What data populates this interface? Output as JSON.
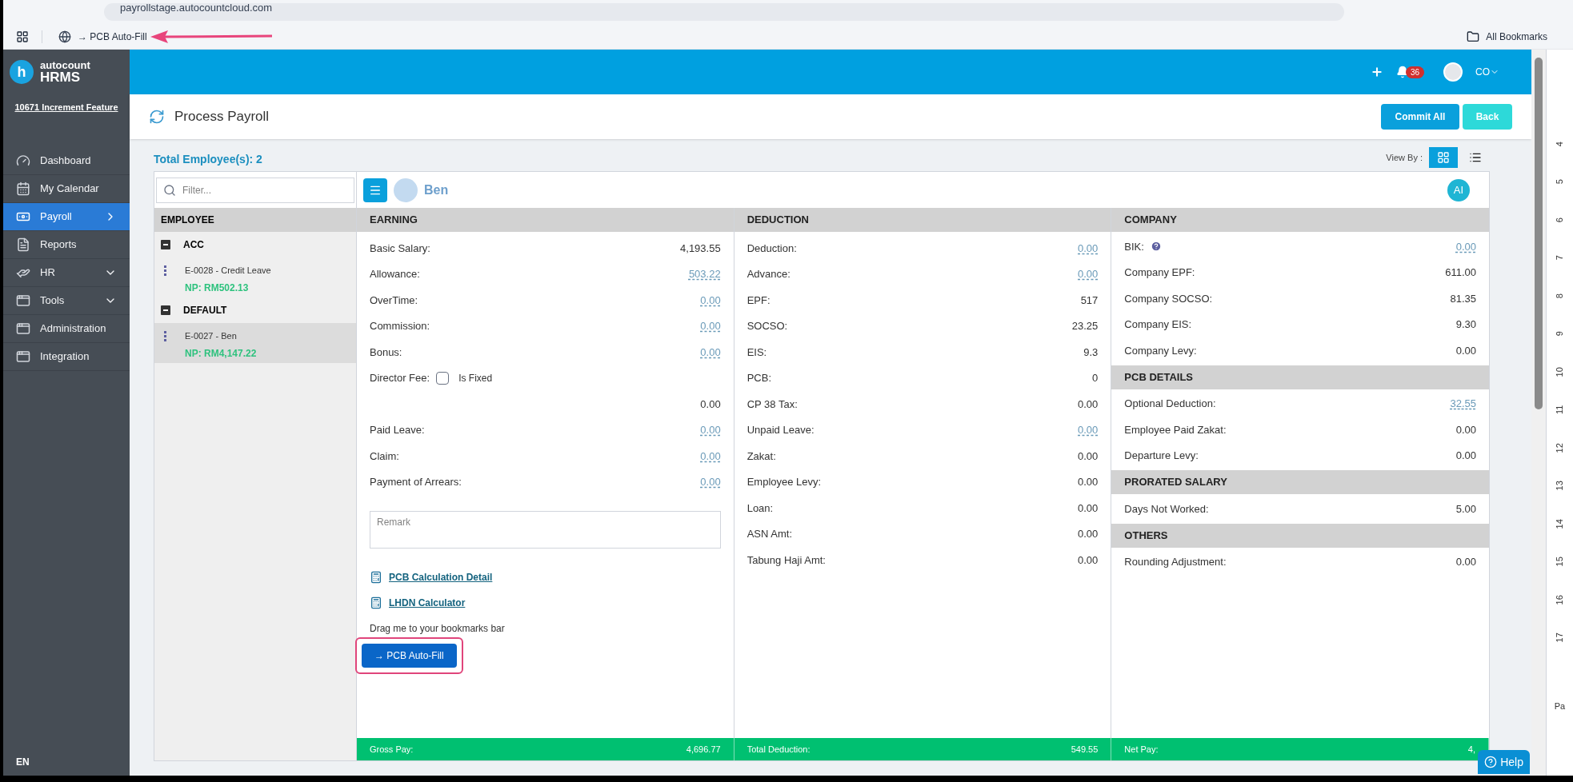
{
  "browser": {
    "url": "payrollstage.autocountcloud.com",
    "bookmarks": [
      {
        "label": "→ PCB Auto-Fill"
      }
    ],
    "all_bookmarks": "All Bookmarks"
  },
  "header": {
    "notifications": "36",
    "user": "CO"
  },
  "sidebar": {
    "logo_letter": "h",
    "logo_top": "autocount",
    "logo_bottom": "HRMS",
    "company": "10671 Increment Feature",
    "language": "EN",
    "items": [
      {
        "label": "Dashboard",
        "kind": "gauge",
        "selected": false,
        "submenu": false
      },
      {
        "label": "My Calendar",
        "kind": "calendar",
        "selected": false,
        "submenu": false
      },
      {
        "label": "Payroll",
        "kind": "money",
        "selected": true,
        "submenu": true
      },
      {
        "label": "Reports",
        "kind": "report",
        "selected": false,
        "submenu": false
      },
      {
        "label": "HR",
        "kind": "hr",
        "selected": false,
        "submenu": true
      },
      {
        "label": "Tools",
        "kind": "panel",
        "selected": false,
        "submenu": true
      },
      {
        "label": "Administration",
        "kind": "panel",
        "selected": false,
        "submenu": false
      },
      {
        "label": "Integration",
        "kind": "panel",
        "selected": false,
        "submenu": false
      }
    ]
  },
  "page": {
    "title": "Process Payroll",
    "buttons": [
      {
        "label": "Commit All",
        "kind": "primary"
      },
      {
        "label": "Back",
        "kind": "secondary"
      }
    ],
    "total": "Total Employee(s): 2",
    "view_by": "View By :",
    "views": [
      {
        "kind": "grid",
        "selected": true
      },
      {
        "kind": "list",
        "selected": false
      }
    ]
  },
  "employees": {
    "filter_placeholder": "Filter...",
    "header": "EMPLOYEE",
    "groups": [
      {
        "name": "ACC",
        "expanded": true,
        "items": [
          {
            "label": "E-0028 - Credit Leave",
            "np": "NP: RM502.13",
            "selected": false
          }
        ]
      },
      {
        "name": "DEFAULT",
        "expanded": true,
        "items": [
          {
            "label": "E-0027 - Ben",
            "np": "NP: RM4,147.22",
            "selected": true
          }
        ]
      }
    ]
  },
  "employee": {
    "name": "Ben",
    "ai_badge": "AI"
  },
  "earning": {
    "header": "EARNING",
    "rows": [
      {
        "kind": "plain",
        "label": "Basic Salary:",
        "value": "4,193.55"
      },
      {
        "kind": "link",
        "label": "Allowance:",
        "value": "503.22"
      },
      {
        "kind": "link",
        "label": "OverTime:",
        "value": "0.00"
      },
      {
        "kind": "link",
        "label": "Commission:",
        "value": "0.00"
      },
      {
        "kind": "link",
        "label": "Bonus:",
        "value": "0.00"
      },
      {
        "kind": "checkbox",
        "label": "Director Fee:",
        "checked": false,
        "check_label": "Is Fixed"
      },
      {
        "kind": "plain",
        "value": "0.00"
      },
      {
        "kind": "link",
        "label": "Paid Leave:",
        "value": "0.00"
      },
      {
        "kind": "link",
        "label": "Claim:",
        "value": "0.00"
      },
      {
        "kind": "link",
        "label": "Payment of Arrears:",
        "value": "0.00"
      }
    ],
    "remark_placeholder": "Remark",
    "links": [
      "PCB Calculation Detail",
      "LHDN Calculator"
    ],
    "drag_hint": "Drag me to your bookmarks bar",
    "bookmarklet": "→ PCB Auto-Fill"
  },
  "deduction": {
    "header": "DEDUCTION",
    "rows": [
      {
        "kind": "link",
        "label": "Deduction:",
        "value": "0.00"
      },
      {
        "kind": "link",
        "label": "Advance:",
        "value": "0.00"
      },
      {
        "kind": "plain",
        "label": "EPF:",
        "value": "517"
      },
      {
        "kind": "plain",
        "label": "SOCSO:",
        "value": "23.25"
      },
      {
        "kind": "plain",
        "label": "EIS:",
        "value": "9.3"
      },
      {
        "kind": "plain",
        "label": "PCB:",
        "value": "0"
      },
      {
        "kind": "plain",
        "label": "CP 38 Tax:",
        "value": "0.00"
      },
      {
        "kind": "link",
        "label": "Unpaid Leave:",
        "value": "0.00"
      },
      {
        "kind": "plain",
        "label": "Zakat:",
        "value": "0.00"
      },
      {
        "kind": "plain",
        "label": "Employee Levy:",
        "value": "0.00"
      },
      {
        "kind": "plain",
        "label": "Loan:",
        "value": "0.00"
      },
      {
        "kind": "plain",
        "label": "ASN Amt:",
        "value": "0.00"
      },
      {
        "kind": "plain",
        "label": "Tabung Haji Amt:",
        "value": "0.00"
      }
    ]
  },
  "company": {
    "sections": [
      {
        "header": "COMPANY",
        "rows": [
          {
            "kind": "help",
            "label": "BIK:",
            "value": "0.00"
          },
          {
            "kind": "plain",
            "label": "Company EPF:",
            "value": "611.00"
          },
          {
            "kind": "plain",
            "label": "Company SOCSO:",
            "value": "81.35"
          },
          {
            "kind": "plain",
            "label": "Company EIS:",
            "value": "9.30"
          },
          {
            "kind": "plain",
            "label": "Company Levy:",
            "value": "0.00"
          }
        ]
      },
      {
        "header": "PCB DETAILS",
        "rows": [
          {
            "kind": "link",
            "label": "Optional Deduction:",
            "value": "32.55"
          },
          {
            "kind": "plain",
            "label": "Employee Paid Zakat:",
            "value": "0.00"
          },
          {
            "kind": "plain",
            "label": "Departure Levy:",
            "value": "0.00"
          }
        ]
      },
      {
        "header": "PRORATED SALARY",
        "rows": [
          {
            "kind": "plain",
            "label": "Days Not Worked:",
            "value": "5.00"
          }
        ]
      },
      {
        "header": "OTHERS",
        "rows": [
          {
            "kind": "plain",
            "label": "Rounding Adjustment:",
            "value": "0.00"
          }
        ]
      }
    ]
  },
  "totals": [
    {
      "label": "Gross Pay:",
      "value": "4,696.77"
    },
    {
      "label": "Total Deduction:",
      "value": "549.55"
    },
    {
      "label": "Net Pay:",
      "value": "4,"
    }
  ],
  "help": "Help",
  "ruler": {
    "labels": [
      "4",
      "5",
      "6",
      "7",
      "8",
      "9",
      "10",
      "11",
      "12",
      "13",
      "14",
      "15",
      "16",
      "17"
    ],
    "page_label": "Pa"
  }
}
